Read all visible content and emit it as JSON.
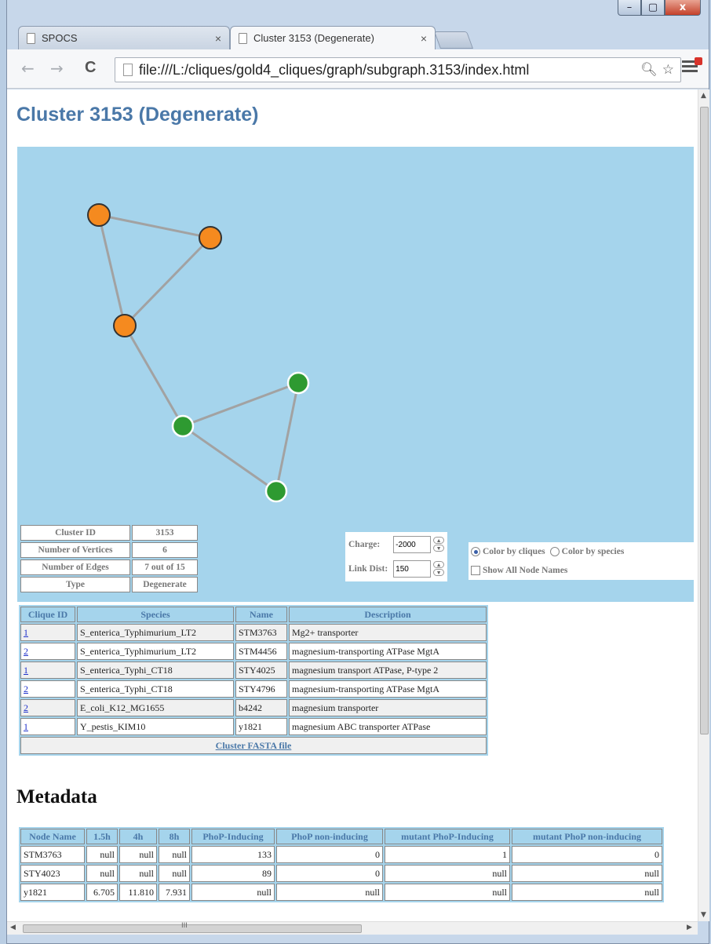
{
  "browser": {
    "tabs": [
      {
        "label": "SPOCS",
        "active": false
      },
      {
        "label": "Cluster 3153 (Degenerate)",
        "active": true
      }
    ],
    "close_glyph": "×",
    "url": "file:///L:/cliques/gold4_cliques/graph/subgraph.3153/index.html",
    "window_controls": {
      "minimize": "–",
      "maximize": "▢",
      "close": "x"
    },
    "nav": {
      "back": "←",
      "forward": "→",
      "reload": "C"
    }
  },
  "page": {
    "title": "Cluster 3153 (Degenerate)"
  },
  "graph": {
    "background": "#a5d4ec",
    "colors": {
      "clique1": "#f58a1f",
      "clique2": "#2e9a31",
      "edge": "#a2a2a2"
    },
    "nodes": [
      {
        "id": "n1",
        "clique": 1
      },
      {
        "id": "n2",
        "clique": 1
      },
      {
        "id": "n3",
        "clique": 1
      },
      {
        "id": "n4",
        "clique": 2
      },
      {
        "id": "n5",
        "clique": 2
      },
      {
        "id": "n6",
        "clique": 2
      }
    ],
    "edges": [
      [
        "n1",
        "n2"
      ],
      [
        "n1",
        "n3"
      ],
      [
        "n2",
        "n3"
      ],
      [
        "n3",
        "n5"
      ],
      [
        "n4",
        "n5"
      ],
      [
        "n5",
        "n6"
      ],
      [
        "n4",
        "n6"
      ]
    ]
  },
  "cluster_info": {
    "rows": [
      {
        "label": "Cluster ID",
        "value": "3153"
      },
      {
        "label": "Number of Vertices",
        "value": "6"
      },
      {
        "label": "Number of Edges",
        "value": "7 out of 15"
      },
      {
        "label": "Type",
        "value": "Degenerate"
      }
    ]
  },
  "controls": {
    "charge_label": "Charge:",
    "charge_value": "-2000",
    "link_label": "Link Dist:",
    "link_value": "150",
    "color_by_cliques": "Color by cliques",
    "color_by_species": "Color by species",
    "show_all_names": "Show All Node Names"
  },
  "clique_table": {
    "headers": [
      "Clique ID",
      "Species",
      "Name",
      "Description"
    ],
    "rows": [
      [
        "1",
        "S_enterica_Typhimurium_LT2",
        "STM3763",
        "Mg2+ transporter"
      ],
      [
        "2",
        "S_enterica_Typhimurium_LT2",
        "STM4456",
        "magnesium-transporting ATPase MgtA"
      ],
      [
        "1",
        "S_enterica_Typhi_CT18",
        "STY4025",
        "magnesium transport ATPase, P-type 2"
      ],
      [
        "2",
        "S_enterica_Typhi_CT18",
        "STY4796",
        "magnesium-transporting ATPase MgtA"
      ],
      [
        "2",
        "E_coli_K12_MG1655",
        "b4242",
        "magnesium transporter"
      ],
      [
        "1",
        "Y_pestis_KIM10",
        "y1821",
        "magnesium ABC transporter ATPase"
      ]
    ],
    "fasta_link": "Cluster FASTA file"
  },
  "metadata": {
    "title": "Metadata",
    "headers": [
      "Node Name",
      "1.5h",
      "4h",
      "8h",
      "PhoP-Inducing",
      "PhoP non-inducing",
      "mutant PhoP-Inducing",
      "mutant PhoP non-inducing"
    ],
    "rows": [
      [
        "STM3763",
        "null",
        "null",
        "null",
        "133",
        "0",
        "1",
        "0"
      ],
      [
        "STY4023",
        "null",
        "null",
        "null",
        "89",
        "0",
        "null",
        "null"
      ],
      [
        "y1821",
        "6.705",
        "11.810",
        "7.931",
        "null",
        "null",
        "null",
        "null"
      ]
    ]
  },
  "scrollbar": {
    "grip": "III"
  }
}
